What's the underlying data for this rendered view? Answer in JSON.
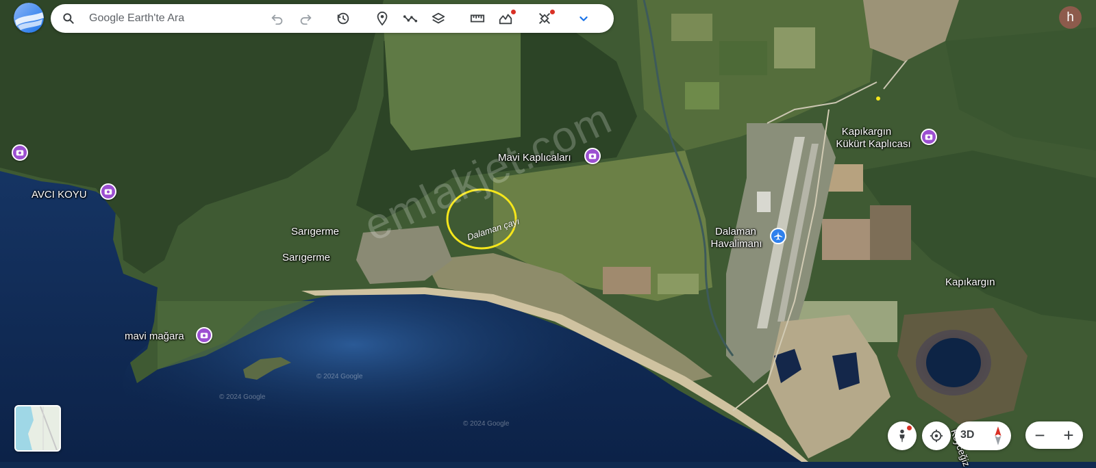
{
  "search": {
    "placeholder": "Google Earth'te Ara"
  },
  "toolbar": {
    "tools": [
      "undo-icon",
      "redo-icon",
      "history-icon",
      "pin-icon",
      "path-icon",
      "layers-icon",
      "ruler-icon",
      "chart-icon",
      "satellite-icon",
      "chevron-down-icon"
    ]
  },
  "user": {
    "avatar_letter": "h"
  },
  "map": {
    "labels": {
      "avci_koyu": "AVCI KOYU",
      "sarigerme_1": "Sarıgerme",
      "sarigerme_2": "Sarıgerme",
      "mavi_magara": "mavi mağara",
      "mavi_kaplicalari": "Mavi Kaplıcaları",
      "dalaman_cayi": "Dalaman çayı",
      "dalaman_havalimani_1": "Dalaman",
      "dalaman_havalimani_2": "Havalimanı",
      "kapikargin_kukurt_1": "Kapıkargın",
      "kapikargin_kukurt_2": "Kükürt Kaplıcası",
      "kapikargin": "Kapıkargın",
      "koycegiz_partial": "Köyceğiz"
    },
    "watermark": "emlakjet.com",
    "credits": [
      "© 2024 Google",
      "© 2024 Google",
      "© 2024 Google"
    ],
    "highlight_color": "#f5e61b"
  },
  "controls": {
    "mode_3d": "3D",
    "zoom_out": "−",
    "zoom_in": "+"
  },
  "colors": {
    "poi": "#9c4fd1",
    "airport": "#2f80ed",
    "sea": "#0f2a50"
  }
}
